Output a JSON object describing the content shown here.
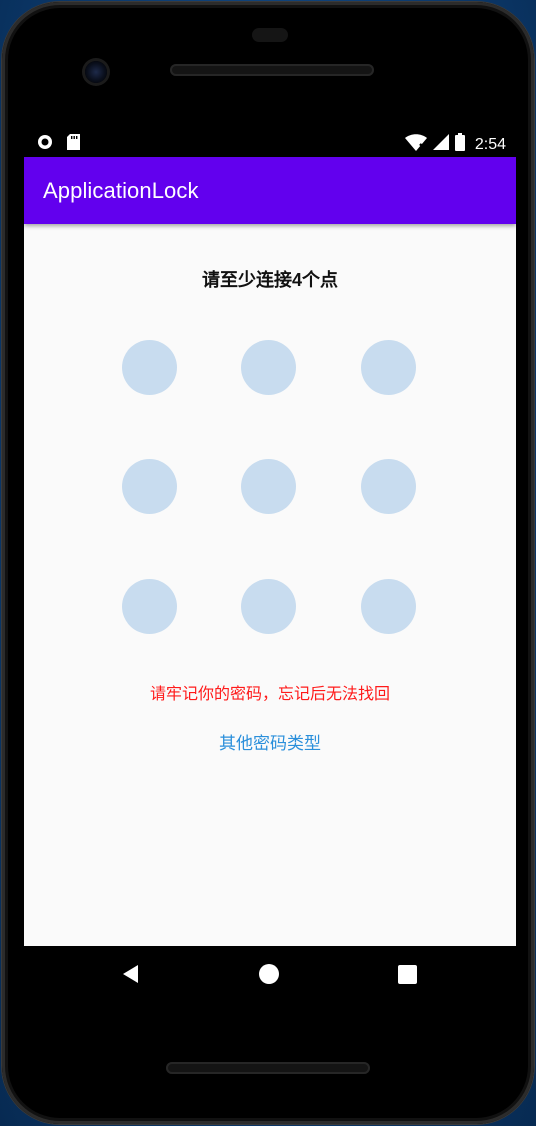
{
  "status_bar": {
    "time": "2:54",
    "left_icons": [
      "circle-notification-icon",
      "sd-card-icon"
    ],
    "right_icons": [
      "wifi-icon",
      "cell-signal-icon",
      "battery-icon"
    ]
  },
  "app_bar": {
    "title": "ApplicationLock",
    "color": "#6200ee"
  },
  "pattern_lock": {
    "hint": "请至少连接4个点",
    "dots": [
      {
        "row": 1,
        "col": 1
      },
      {
        "row": 1,
        "col": 2
      },
      {
        "row": 1,
        "col": 3
      },
      {
        "row": 2,
        "col": 1
      },
      {
        "row": 2,
        "col": 2
      },
      {
        "row": 2,
        "col": 3
      },
      {
        "row": 3,
        "col": 1
      },
      {
        "row": 3,
        "col": 2
      },
      {
        "row": 3,
        "col": 3
      }
    ],
    "dot_color": "#c8dcef",
    "warning": "请牢记你的密码，忘记后无法找回",
    "warning_color": "#ff1a1a",
    "other_types_link": "其他密码类型",
    "link_color": "#2a8fdb"
  },
  "nav_bar": {
    "buttons": [
      "back-icon",
      "home-icon",
      "recents-icon"
    ]
  }
}
